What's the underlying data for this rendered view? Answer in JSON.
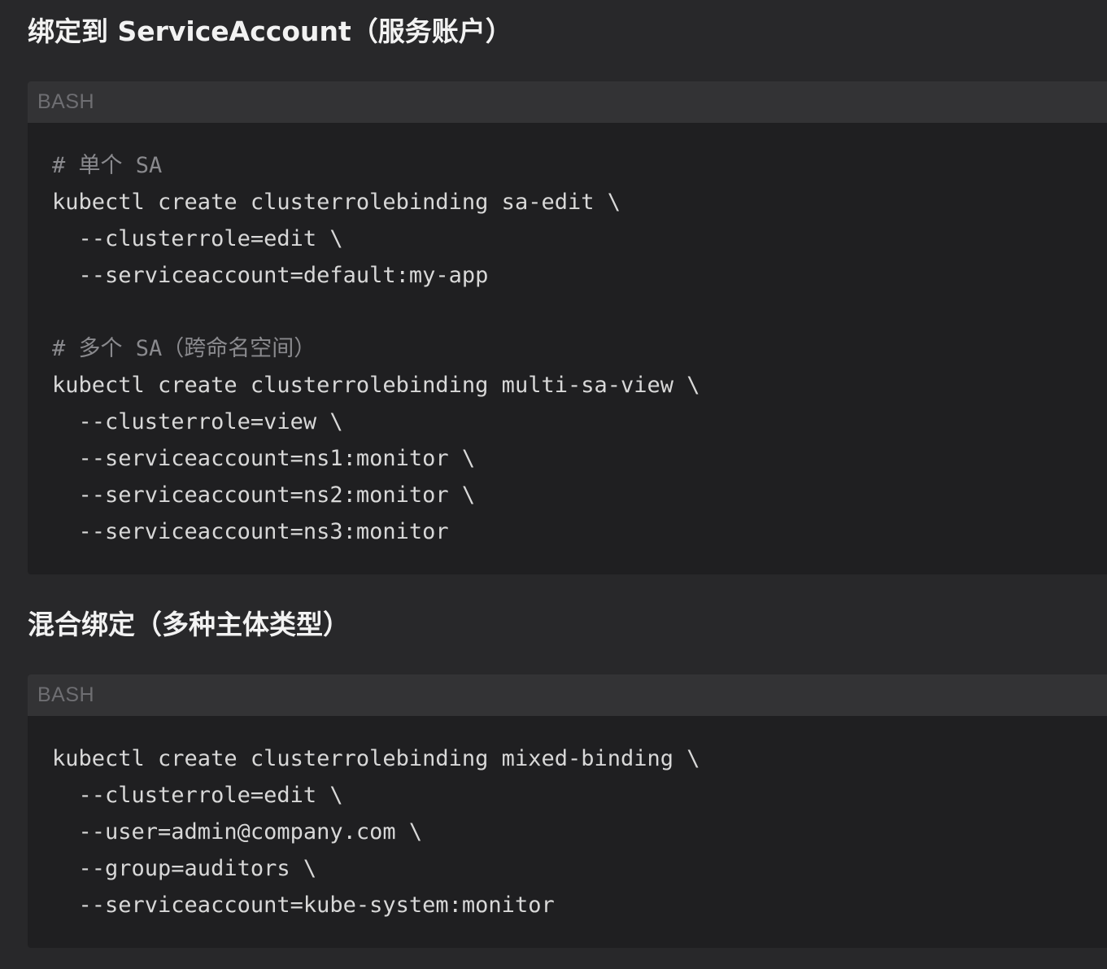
{
  "section1": {
    "title": "绑定到 ServiceAccount（服务账户）",
    "code": {
      "language": "BASH",
      "lines": [
        {
          "text": "# 单个 SA",
          "kind": "comment"
        },
        {
          "text": "kubectl create clusterrolebinding sa-edit \\",
          "kind": "code"
        },
        {
          "text": "  --clusterrole=edit \\",
          "kind": "code"
        },
        {
          "text": "  --serviceaccount=default:my-app",
          "kind": "code"
        },
        {
          "text": "",
          "kind": "blank"
        },
        {
          "text": "# 多个 SA（跨命名空间）",
          "kind": "comment"
        },
        {
          "text": "kubectl create clusterrolebinding multi-sa-view \\",
          "kind": "code"
        },
        {
          "text": "  --clusterrole=view \\",
          "kind": "code"
        },
        {
          "text": "  --serviceaccount=ns1:monitor \\",
          "kind": "code"
        },
        {
          "text": "  --serviceaccount=ns2:monitor \\",
          "kind": "code"
        },
        {
          "text": "  --serviceaccount=ns3:monitor",
          "kind": "code"
        }
      ]
    }
  },
  "section2": {
    "title": "混合绑定（多种主体类型）",
    "code": {
      "language": "BASH",
      "lines": [
        {
          "text": "kubectl create clusterrolebinding mixed-binding \\",
          "kind": "code"
        },
        {
          "text": "  --clusterrole=edit \\",
          "kind": "code"
        },
        {
          "text": "  --user=admin@company.com \\",
          "kind": "code"
        },
        {
          "text": "  --group=auditors \\",
          "kind": "code"
        },
        {
          "text": "  --serviceaccount=kube-system:monitor",
          "kind": "code"
        }
      ]
    }
  }
}
